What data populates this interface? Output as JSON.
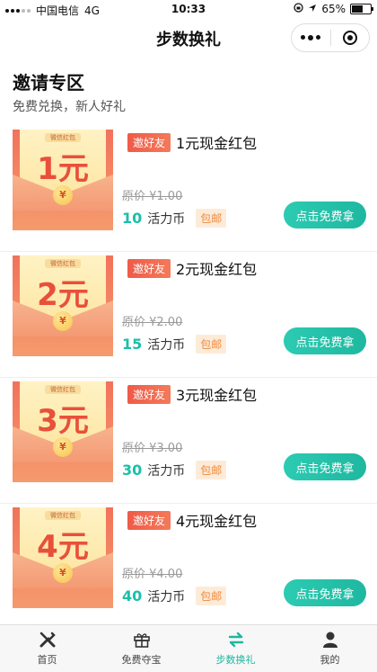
{
  "status": {
    "carrier": "中国电信",
    "network": "4G",
    "time": "10:33",
    "battery": "65%",
    "battery_level": 0.65
  },
  "nav": {
    "title": "步数换礼",
    "more_icon": "more-dots-icon",
    "close_icon": "target-icon"
  },
  "section": {
    "title": "邀请专区",
    "subtitle": "免费兑换，新人好礼"
  },
  "items": [
    {
      "tag": "邀好友",
      "name": "1元现金红包",
      "thumb_label": "微信红包",
      "thumb_amount": "1元",
      "coin": "¥",
      "original_price": "原价 ¥1.00",
      "coin_price": "10",
      "coin_unit": "活力币",
      "shipping": "包邮",
      "button": "点击免费拿"
    },
    {
      "tag": "邀好友",
      "name": "2元现金红包",
      "thumb_label": "微信红包",
      "thumb_amount": "2元",
      "coin": "¥",
      "original_price": "原价 ¥2.00",
      "coin_price": "15",
      "coin_unit": "活力币",
      "shipping": "包邮",
      "button": "点击免费拿"
    },
    {
      "tag": "邀好友",
      "name": "3元现金红包",
      "thumb_label": "微信红包",
      "thumb_amount": "3元",
      "coin": "¥",
      "original_price": "原价 ¥3.00",
      "coin_price": "30",
      "coin_unit": "活力币",
      "shipping": "包邮",
      "button": "点击免费拿"
    },
    {
      "tag": "邀好友",
      "name": "4元现金红包",
      "thumb_label": "微信红包",
      "thumb_amount": "4元",
      "coin": "¥",
      "original_price": "原价 ¥4.00",
      "coin_price": "40",
      "coin_unit": "活力币",
      "shipping": "包邮",
      "button": "点击免费拿"
    }
  ],
  "tabs": [
    {
      "label": "首页",
      "icon": "home-tools-icon",
      "active": false
    },
    {
      "label": "免费夺宝",
      "icon": "gift-icon",
      "active": false
    },
    {
      "label": "步数换礼",
      "icon": "exchange-icon",
      "active": true
    },
    {
      "label": "我的",
      "icon": "user-icon",
      "active": false
    }
  ],
  "colors": {
    "accent": "#1fb7a0",
    "tag_red": "#ef5a48",
    "envelope": "#f2725b"
  }
}
